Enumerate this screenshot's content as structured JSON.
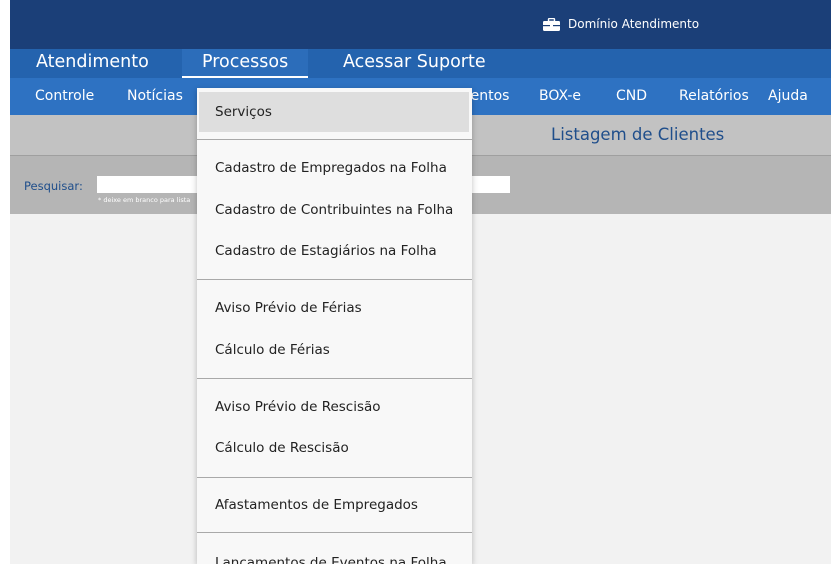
{
  "header": {
    "brand_icon": "briefcase-icon",
    "brand_label": "Domínio Atendimento"
  },
  "main_nav": {
    "items": [
      "Atendimento",
      "Processos",
      "Acessar Suporte"
    ],
    "active": "Processos"
  },
  "sub_nav": {
    "items": [
      "Controle",
      "Notícias",
      "mentos",
      "BOX-e",
      "CND",
      "Relatórios",
      "Ajuda"
    ]
  },
  "page": {
    "title": "Listagem de Clientes"
  },
  "search": {
    "label": "Pesquisar:",
    "value": "",
    "hint": "* deixe em branco para lista"
  },
  "dropdown": {
    "selected": "Serviços",
    "items": [
      "Serviços",
      "Cadastro de Empregados na Folha",
      "Cadastro de Contribuintes na Folha",
      "Cadastro de Estagiários na Folha",
      "Aviso Prévio de Férias",
      "Cálculo de Férias",
      "Aviso Prévio de Rescisão",
      "Cálculo de Rescisão",
      "Afastamentos de Empregados",
      "Lançamentos de Eventos na Folha"
    ]
  },
  "colors": {
    "header_bg": "#1b3f78",
    "main_nav_bg": "#2463ae",
    "sub_nav_bg": "#2e72c2",
    "title_bar_bg": "#c2c2c2",
    "search_bar_bg": "#b5b5b5",
    "title_text": "#1f4e8b",
    "menu_bg": "#f8f8f8",
    "menu_selected_bg": "#dedede"
  }
}
